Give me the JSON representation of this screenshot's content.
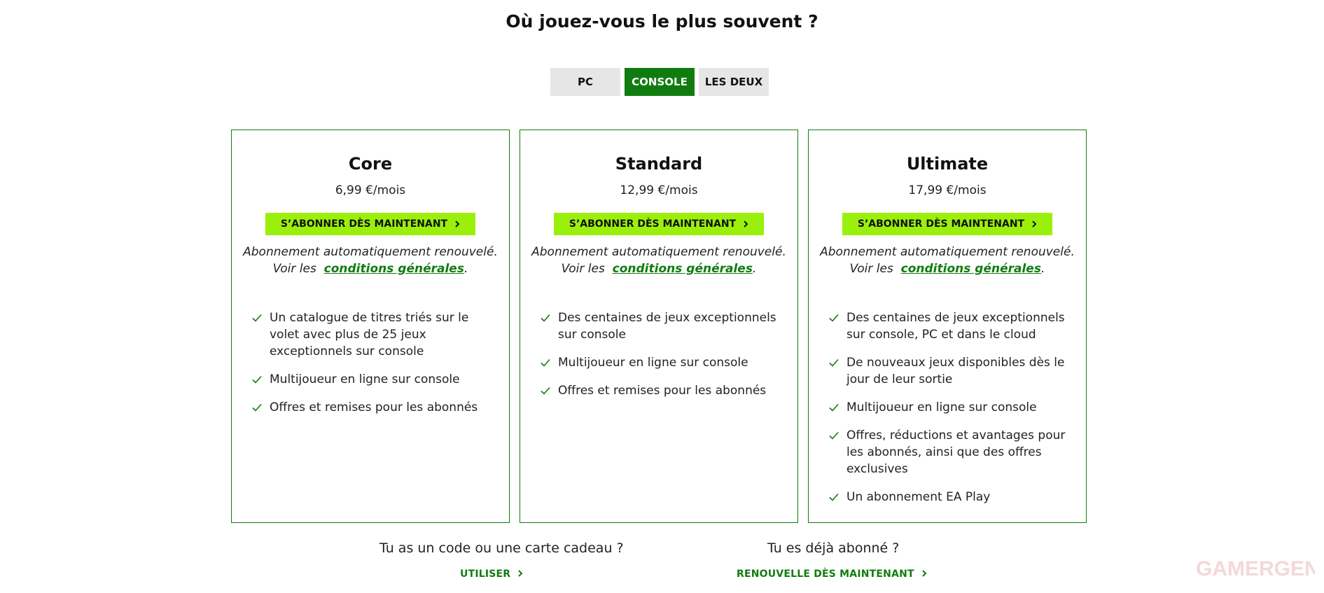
{
  "heading": "Où jouez-vous le plus souvent ?",
  "platforms": [
    {
      "label": "PC",
      "active": false
    },
    {
      "label": "CONSOLE",
      "active": true
    },
    {
      "label": "LES DEUX",
      "active": false
    }
  ],
  "colors": {
    "accent_green": "#107c10",
    "cta_lime": "#9bf00b",
    "toggle_bg": "#e6e6e6"
  },
  "plans": [
    {
      "name": "Core",
      "price": "6,99 €/mois",
      "cta": "S’ABONNER DÈS MAINTENANT",
      "note_line1": "Abonnement automatiquement renouvelé.",
      "note_prefix": "Voir les",
      "note_link": "conditions générales",
      "note_suffix": ".",
      "features": [
        "Un catalogue de titres triés sur le volet avec plus de 25 jeux exceptionnels sur console",
        "Multijoueur en ligne sur console",
        "Offres et remises pour les abonnés"
      ]
    },
    {
      "name": "Standard",
      "price": "12,99 €/mois",
      "cta": "S’ABONNER DÈS MAINTENANT",
      "note_line1": "Abonnement automatiquement renouvelé.",
      "note_prefix": "Voir les",
      "note_link": "conditions générales",
      "note_suffix": ".",
      "features": [
        "Des centaines de jeux exceptionnels sur console",
        "Multijoueur en ligne sur console",
        "Offres et remises pour les abonnés"
      ]
    },
    {
      "name": "Ultimate",
      "price": "17,99 €/mois",
      "cta": "S’ABONNER DÈS MAINTENANT",
      "note_line1": "Abonnement automatiquement renouvelé.",
      "note_prefix": "Voir les",
      "note_link": "conditions générales",
      "note_suffix": ".",
      "features": [
        "Des centaines de jeux exceptionnels sur console, PC et dans le cloud",
        "De nouveaux jeux disponibles dès le jour de leur sortie",
        "Multijoueur en ligne sur console",
        "Offres, réductions et avantages pour les abonnés, ainsi que des offres exclusives",
        "Un abonnement EA Play"
      ]
    }
  ],
  "icons": {
    "cta_arrow": "chevron-right-icon",
    "feature_bullet": "check-icon"
  },
  "footer": {
    "gift_question": "Tu as un code ou une carte cadeau ?",
    "gift_link": "UTILISER",
    "renew_question": "Tu es déjà abonné ?",
    "renew_link": "RENOUVELLE DÈS MAINTENANT"
  },
  "watermark": "GAMERGEN"
}
